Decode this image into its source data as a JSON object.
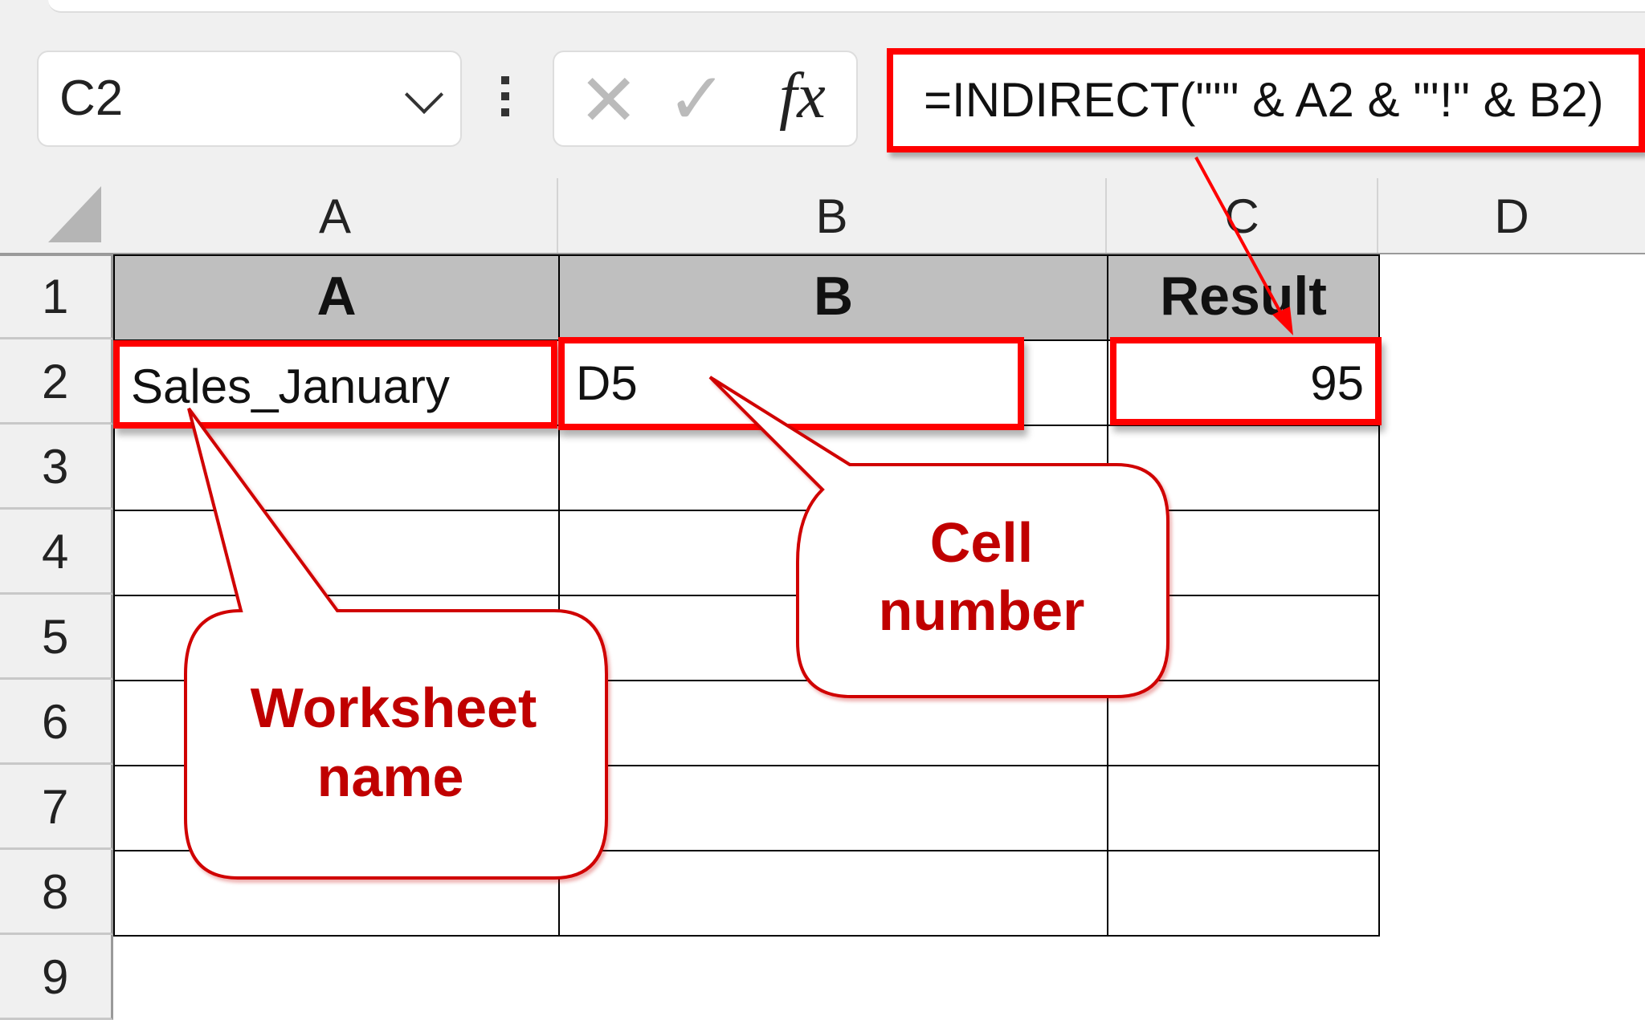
{
  "formula_bar": {
    "name_box": "C2",
    "cancel_icon": "x-icon",
    "enter_icon": "check-icon",
    "fx_label": "fx",
    "formula": "=INDIRECT(\"'\" & A2 & \"'!\" & B2)"
  },
  "columns": [
    "A",
    "B",
    "C",
    "D"
  ],
  "rows": [
    "1",
    "2",
    "3",
    "4",
    "5",
    "6",
    "7",
    "8",
    "9"
  ],
  "table": {
    "headers": [
      "A",
      "B",
      "Result"
    ],
    "row2": [
      "Sales_January",
      "D5",
      "95"
    ]
  },
  "annotations": {
    "worksheet": [
      "Worksheet",
      "name"
    ],
    "cell": [
      "Cell",
      "number"
    ]
  },
  "colors": {
    "highlight": "#ff0000",
    "annotation_text": "#c00000",
    "header_fill": "#bfbfbf"
  }
}
